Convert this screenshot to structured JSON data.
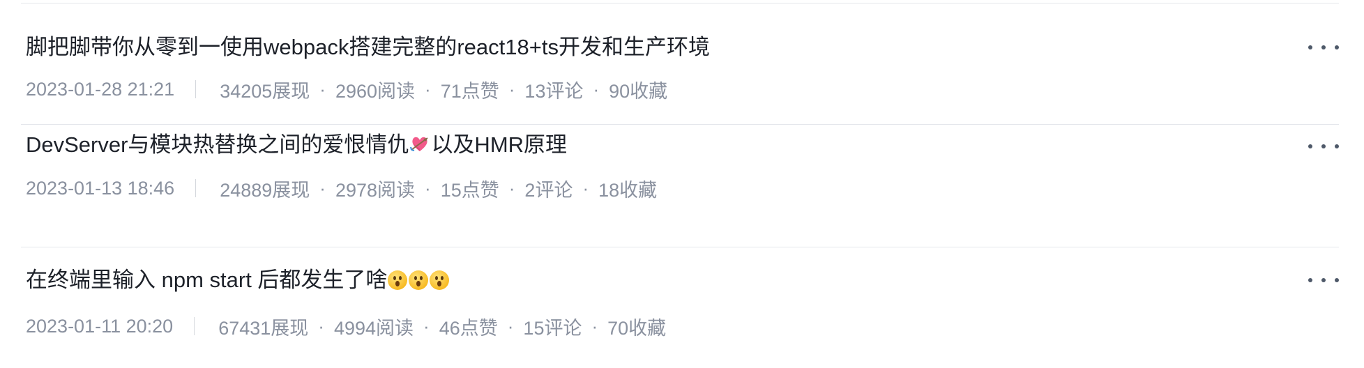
{
  "articles": [
    {
      "title": "脚把脚带你从零到一使用webpack搭建完整的react18+ts开发和生产环境",
      "date": "2023-01-28 21:21",
      "views": "34205展现",
      "reads": "2960阅读",
      "likes": "71点赞",
      "comments": "13评论",
      "favorites": "90收藏"
    },
    {
      "title_before": "DevServer与模块热替换之间的爱恨情仇",
      "title_emoji": "heart-with-arrow-icon",
      "title_after": "以及HMR原理",
      "date": "2023-01-13 18:46",
      "views": "24889展现",
      "reads": "2978阅读",
      "likes": "15点赞",
      "comments": "2评论",
      "favorites": "18收藏"
    },
    {
      "title": "在终端里输入 npm start 后都发生了啥",
      "title_emoji": "astonished-face-icon",
      "date": "2023-01-11 20:20",
      "views": "67431展现",
      "reads": "4994阅读",
      "likes": "46点赞",
      "comments": "15评论",
      "favorites": "70收藏"
    }
  ],
  "meta_dot": "·",
  "colors": {
    "title": "#1d2129",
    "meta": "#8a919f",
    "divider": "#e4e6eb",
    "more_icon": "#4e5969"
  }
}
